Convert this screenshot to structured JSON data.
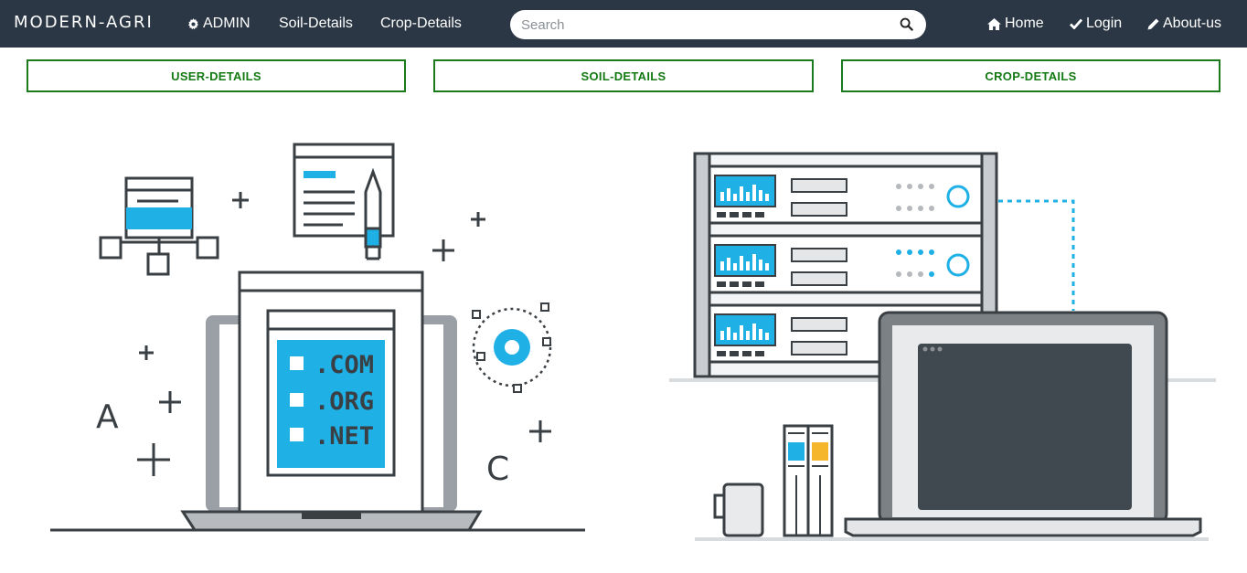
{
  "navbar": {
    "brand": "MODERN-AGRI",
    "admin_label": "ADMIN",
    "soil_label": "Soil-Details",
    "crop_label": "Crop-Details",
    "search_placeholder": "Search",
    "home_label": "Home",
    "login_label": "Login",
    "about_label": "About-us"
  },
  "buttons": {
    "user_details": "USER-DETAILS",
    "soil_details": "SOIL-DETAILS",
    "crop_details": "CROP-DETAILS"
  },
  "illustration_left": {
    "domains": [
      ".COM",
      ".ORG",
      ".NET"
    ],
    "letters": [
      "A",
      "C"
    ]
  },
  "colors": {
    "navbar_bg": "#2b3745",
    "button_border": "#1b7a1b",
    "button_text": "#137a13",
    "accent_blue": "#1fb0e6",
    "accent_orange": "#f5b62b"
  }
}
